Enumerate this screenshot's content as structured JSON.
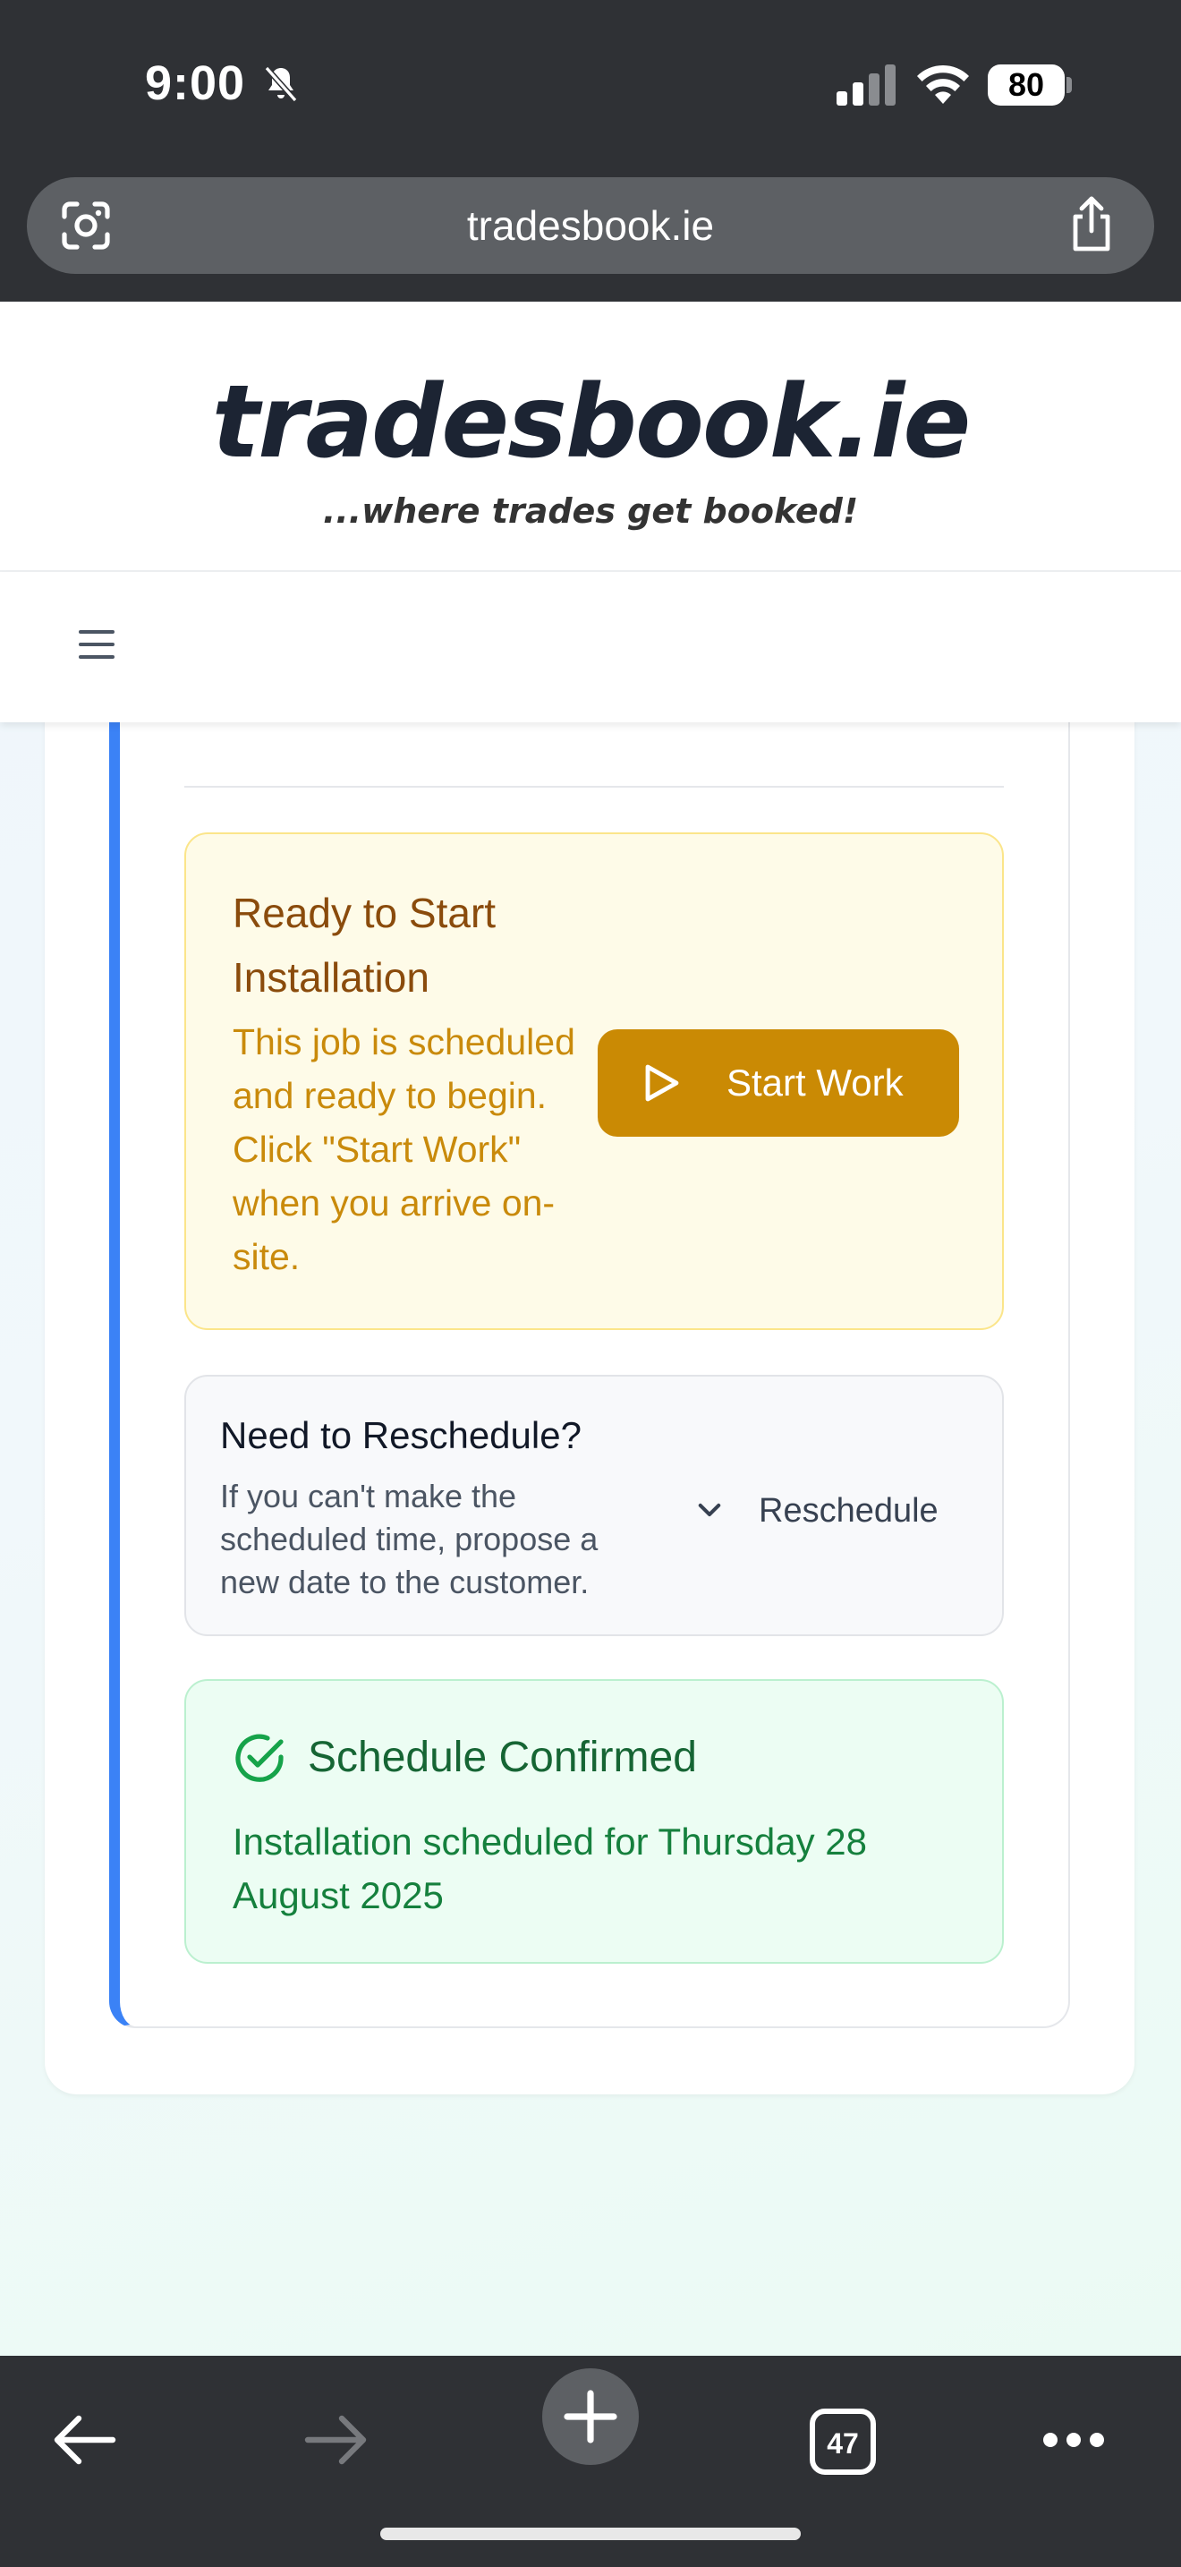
{
  "status_bar": {
    "time": "9:00",
    "battery": "80"
  },
  "browser": {
    "url": "tradesbook.ie",
    "tab_count": "47"
  },
  "site": {
    "logo": "tradesbook.ie",
    "tagline": "...where trades get booked!"
  },
  "ready": {
    "title": "Ready to Start Installation",
    "description": "This job is scheduled and ready to begin. Click \"Start Work\" when you arrive on-site.",
    "button_label": "Start Work"
  },
  "reschedule": {
    "title": "Need to Reschedule?",
    "description": "If you can't make the scheduled time, propose a new date to the customer.",
    "toggle_label": "Reschedule"
  },
  "confirmed": {
    "title": "Schedule Confirmed",
    "description": "Installation scheduled for Thursday 28 August 2025"
  },
  "colors": {
    "accent_blue": "#3b82f6",
    "warning_button": "#ca8a04",
    "success_text": "#166534"
  }
}
